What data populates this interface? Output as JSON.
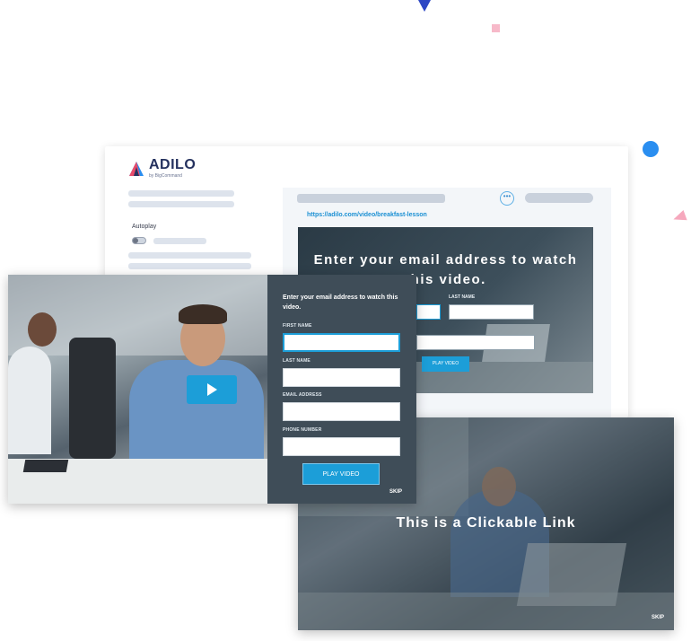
{
  "brand": {
    "name": "ADILO",
    "subtitle": "by BigCommand"
  },
  "dashboard": {
    "autoplay_label": "Autoplay",
    "url": "https://adilo.com/video/breakfast-lesson",
    "more_icon": "ellipsis-icon"
  },
  "video_preview": {
    "title": "Enter your email address to watch this video.",
    "last_name_label": "LAST NAME",
    "button": "PLAY VIDEO"
  },
  "email_gate": {
    "title": "Enter your email address to watch this video.",
    "fields": [
      {
        "label": "FIRST NAME",
        "value": ""
      },
      {
        "label": "LAST NAME",
        "value": ""
      },
      {
        "label": "EMAIL ADDRESS",
        "value": ""
      },
      {
        "label": "PHONE NUMBER",
        "value": ""
      }
    ],
    "button": "PLAY VIDEO",
    "skip": "SKIP",
    "play_icon": "play-icon"
  },
  "link_card": {
    "text": "This is a Clickable Link",
    "skip": "SKIP"
  },
  "colors": {
    "accent": "#1c9ed8",
    "brand_navy": "#24315e",
    "form_bg": "#3f4d58"
  }
}
